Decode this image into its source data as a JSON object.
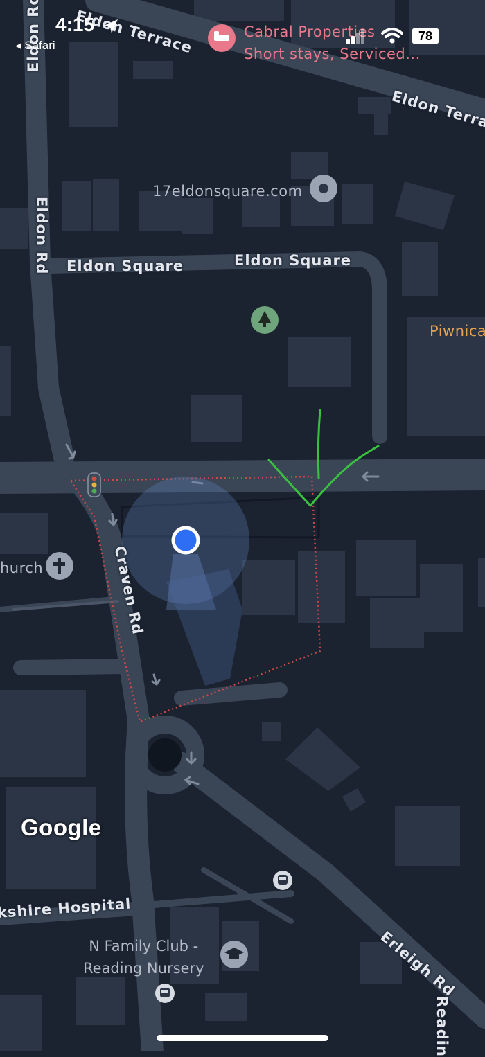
{
  "status_bar": {
    "time": "4:15",
    "back_label": "Safari",
    "battery": "78",
    "icons": [
      "location-arrow-icon",
      "cellular-signal-icon",
      "wifi-icon",
      "battery-icon"
    ]
  },
  "roads": {
    "eldon_terrace_top": "Eldon Terrace",
    "eldon_terrace_right": "Eldon Terrac",
    "eldon_rd_top": "Eldon Ro",
    "eldon_rd": "Eldon Rd",
    "eldon_square_left": "Eldon Square",
    "eldon_square_right": "Eldon Square",
    "craven_rd": "Craven Rd",
    "hospital": "kshire Hospital",
    "erleigh_rd": "Erleigh Rd",
    "reading": "Readin"
  },
  "places": {
    "cabral_name": "Cabral Properties",
    "cabral_desc": "Short stays, Serviced...",
    "website": "17eldonsquare.com",
    "piwnica": "Piwnica",
    "church": "hurch",
    "nursery_line1": "N Family Club -",
    "nursery_line2": "Reading Nursery"
  },
  "icons": {
    "hotel": "bed-icon",
    "website": "place-dot-icon",
    "park": "tree-icon",
    "church": "cross-icon",
    "nursery": "graduation-cap-icon",
    "bus": "bus-icon",
    "traffic": "traffic-light-icon",
    "location": "my-location-icon"
  },
  "colors": {
    "background": "#1b2230",
    "road": "#3a4656",
    "building": "#2b3546",
    "hotel_pin": "#e8788a",
    "park_pin": "#6fa57c",
    "location_dot": "#2e6ef5",
    "annotation_green": "#39c23f",
    "boundary_red": "#d04848",
    "piwnica_label": "#e8a24f"
  },
  "branding": {
    "google": "Google"
  }
}
